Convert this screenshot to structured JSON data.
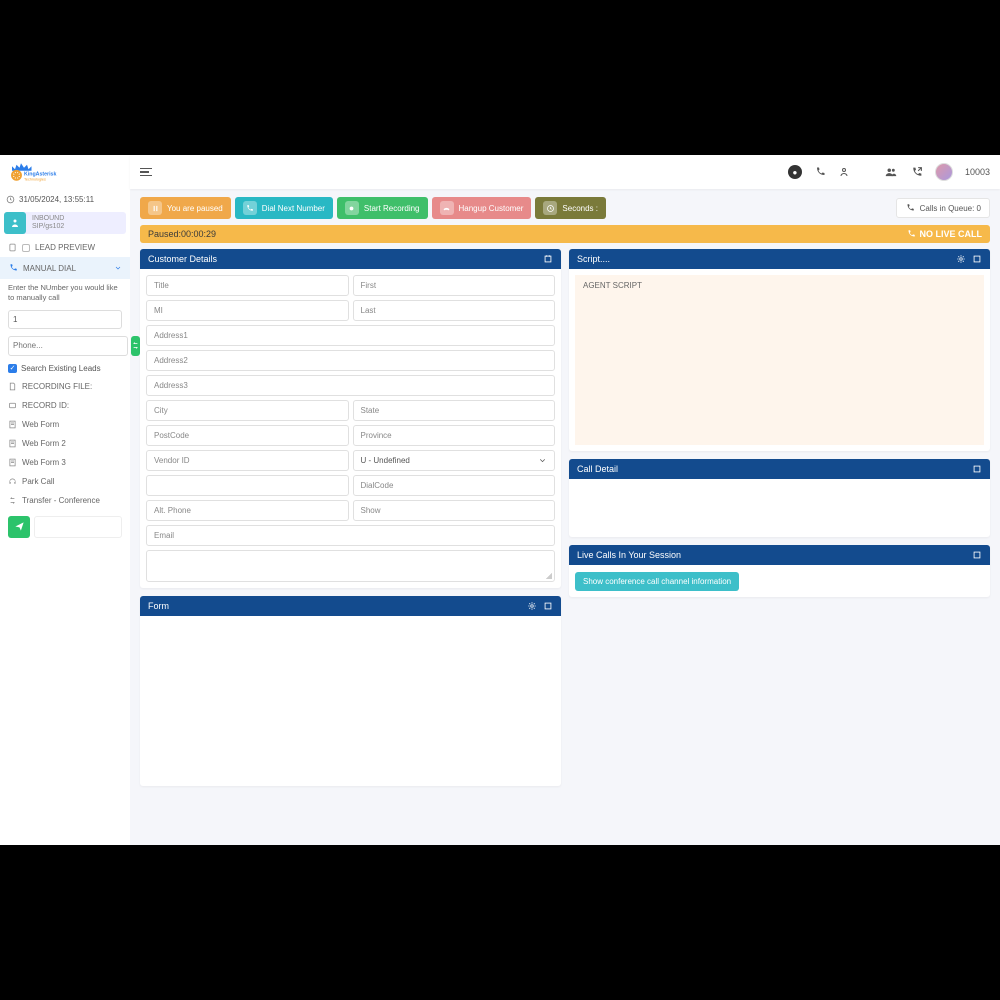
{
  "logo": {
    "line1": "KingAsterisk",
    "line2": "Technologies"
  },
  "datetime": "31/05/2024, 13:55:11",
  "inbound": {
    "title": "INBOUND",
    "sub": "SIP/gs102"
  },
  "sidebar": {
    "lead_preview": "LEAD PREVIEW",
    "manual_dial": "MANUAL DIAL",
    "manual_note": "Enter the NUmber you would like to manually call",
    "manual_value": "1",
    "phone_placeholder": "Phone...",
    "search_leads": "Search Existing Leads",
    "recording_file": "RECORDING FILE:",
    "record_id": "RECORD ID:",
    "webform": "Web Form",
    "webform2": "Web Form 2",
    "webform3": "Web Form 3",
    "park_call": "Park Call",
    "transfer": "Transfer - Conference"
  },
  "header": {
    "user_id": "10003"
  },
  "actions": {
    "paused": "You are paused",
    "dial_next": "Dial Next Number",
    "start_rec": "Start Recording",
    "hangup": "Hangup Customer",
    "seconds": "Seconds :",
    "queue": "Calls in Queue: 0"
  },
  "status": {
    "left": "Paused:00:00:29",
    "right": "NO LIVE CALL"
  },
  "panels": {
    "customer": "Customer Details",
    "script": "Script....",
    "call_detail": "Call Detail",
    "form": "Form",
    "live_calls": "Live Calls In Your Session"
  },
  "fields": {
    "title": "Title",
    "first": "First",
    "mi": "MI",
    "last": "Last",
    "addr1": "Address1",
    "addr2": "Address2",
    "addr3": "Address3",
    "city": "City",
    "state": "State",
    "postcode": "PostCode",
    "province": "Province",
    "vendor": "Vendor ID",
    "gender": "U - Undefined",
    "dialcode": "DialCode",
    "altphone": "Alt. Phone",
    "show": "Show",
    "email": "Email"
  },
  "script_text": "AGENT SCRIPT",
  "live_calls_btn": "Show conference call channel information"
}
